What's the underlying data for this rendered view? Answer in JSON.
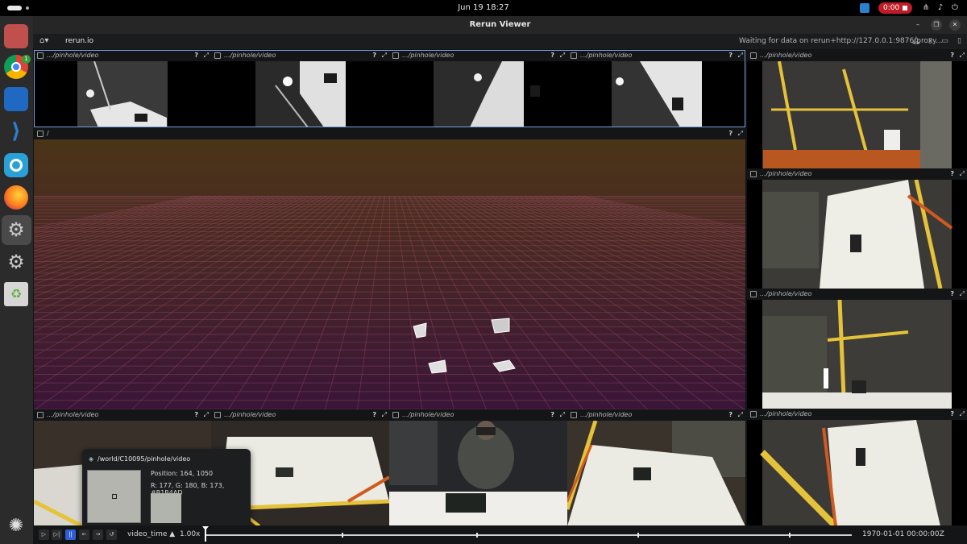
{
  "topbar": {
    "date_time": "Jun 19  18:27",
    "recording_time": "0:00"
  },
  "dock": {
    "apps": [
      {
        "name": "files-icon",
        "color": "#c0504d"
      },
      {
        "name": "chrome-icon",
        "color": "#e8b518",
        "badge": "1"
      },
      {
        "name": "remote-desktop-icon",
        "color": "#2069c2"
      },
      {
        "name": "vscode-icon",
        "color": "#2a7fd4"
      },
      {
        "name": "sync-icon",
        "color": "#2aa1d6"
      },
      {
        "name": "firefox-icon",
        "color": "#ff7a1a"
      },
      {
        "name": "settings-icon",
        "color": "#9a9a9a"
      },
      {
        "name": "settings-icon-2",
        "color": "#9a9a9a"
      },
      {
        "name": "trash-icon",
        "color": "#6ab04c"
      },
      {
        "name": "show-apps-icon",
        "color": "#e0e0e0"
      }
    ]
  },
  "window": {
    "title": "Rerun Viewer"
  },
  "menubar": {
    "brand": "rerun.io",
    "status": "Waiting for data on rerun+http://127.0.0.1:9876/proxy..."
  },
  "panels": {
    "video_title": ".../pinhole/video",
    "root_title": "/",
    "help": "?",
    "expand": "⤢"
  },
  "tooltip": {
    "entity_path": "/world/C10095/pinhole/video",
    "position": "Position:  164, 1050",
    "rgb": "R: 177, G: 180, B: 173, #B1B4AD",
    "swatch_color": "#b1b4ad"
  },
  "timepanel": {
    "timeline": "video_time",
    "speed": "1.00x",
    "timestamp": "1970-01-01 00:00:00Z",
    "playhead_fraction": 0.0
  },
  "colors": {
    "accent": "#2e5fd6",
    "selection": "#7aa0e0",
    "record": "#c01c28"
  }
}
